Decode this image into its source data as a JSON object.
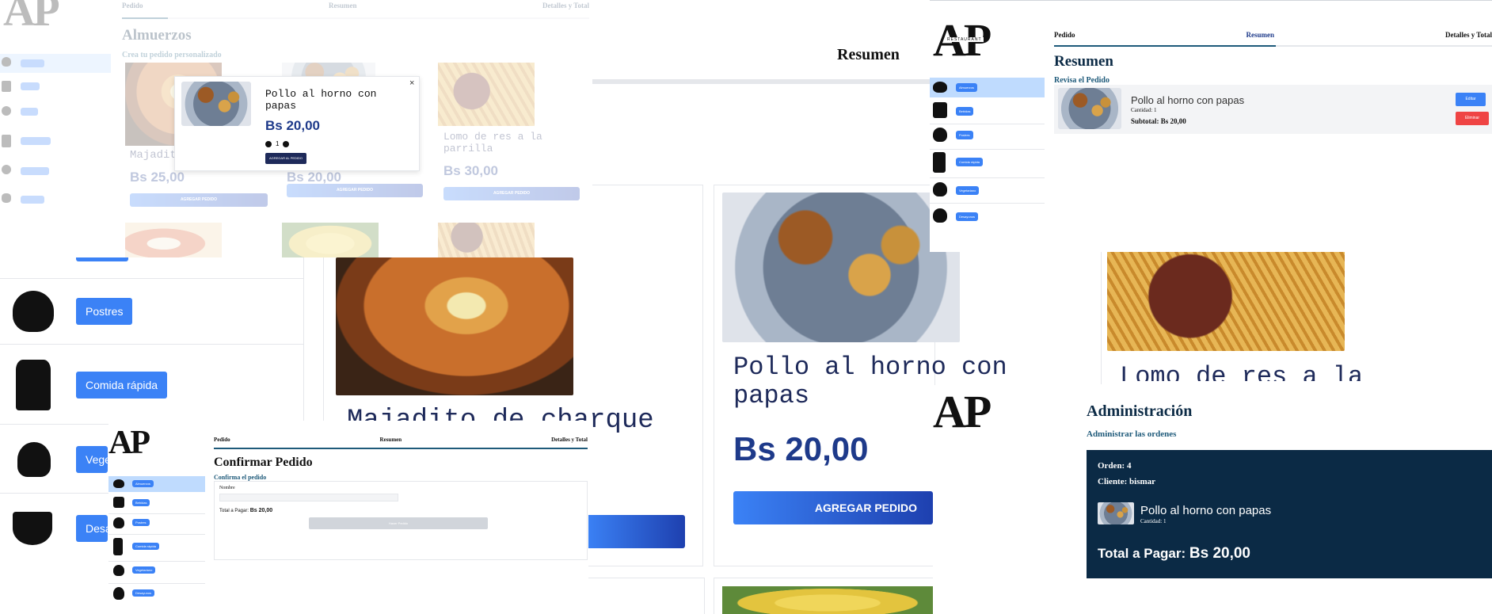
{
  "brand": {
    "logo": "AP",
    "sub": "RESTAURANT"
  },
  "tabs": [
    "Pedido",
    "Resumen",
    "Detalles y Total"
  ],
  "categories": [
    "Almuerzos",
    "Bebidas",
    "Postres",
    "Comida rápida",
    "Vegetariano",
    "Desayunos"
  ],
  "menu": {
    "title": "Almuerzos",
    "subtitle": "Crea tu pedido personalizado",
    "items": [
      {
        "name": "Majadito de charque",
        "price": "Bs 25,00"
      },
      {
        "name": "Pollo al horno con papas",
        "price": "Bs 20,00"
      },
      {
        "name": "Lomo de res a la parrilla",
        "price": "Bs 30,00"
      }
    ],
    "add_label": "AGREGAR PEDIDO"
  },
  "modal": {
    "name": "Pollo al horno con papas",
    "price": "Bs 20,00",
    "qty": "1",
    "add_label": "AGREGAR AL PEDIDO",
    "close": "×"
  },
  "mid": {
    "resumen": "Resumen",
    "maja_name": "Majadito de charque",
    "pollo_name": "Pollo al horno con papas",
    "pollo_price": "Bs 20,00",
    "add_label": "AGREGAR PEDIDO",
    "lomo_name": "Lomo de res a la"
  },
  "big_cats": [
    "Postres",
    "Comida rápida",
    "Vegetariano",
    "Desayunos"
  ],
  "summary": {
    "title": "Resumen",
    "subtitle": "Revisa el Pedido",
    "item_name": "Pollo al horno con papas",
    "qty": "Cantidad: 1",
    "subtotal": "Subtotal: Bs 20,00",
    "edit": "Editar",
    "delete": "Eliminar"
  },
  "confirm": {
    "title": "Confirmar Pedido",
    "subtitle": "Confirma el pedido",
    "name_label": "Nombre",
    "total_label": "Total a Pagar:",
    "total": "Bs 20,00",
    "button": "Hacer Pedido"
  },
  "admin": {
    "title": "Administración",
    "subtitle": "Administrar las ordenes",
    "order": "Orden: 4",
    "client": "Cliente: bismar",
    "item": "Pollo al horno con papas",
    "qty": "Cantidad: 1",
    "total_label": "Total a Pagar:",
    "total": "Bs 20,00"
  },
  "colors": {
    "accent": "#3b82f6",
    "navy": "#0b2a45",
    "dark_blue": "#1e3a8a"
  }
}
